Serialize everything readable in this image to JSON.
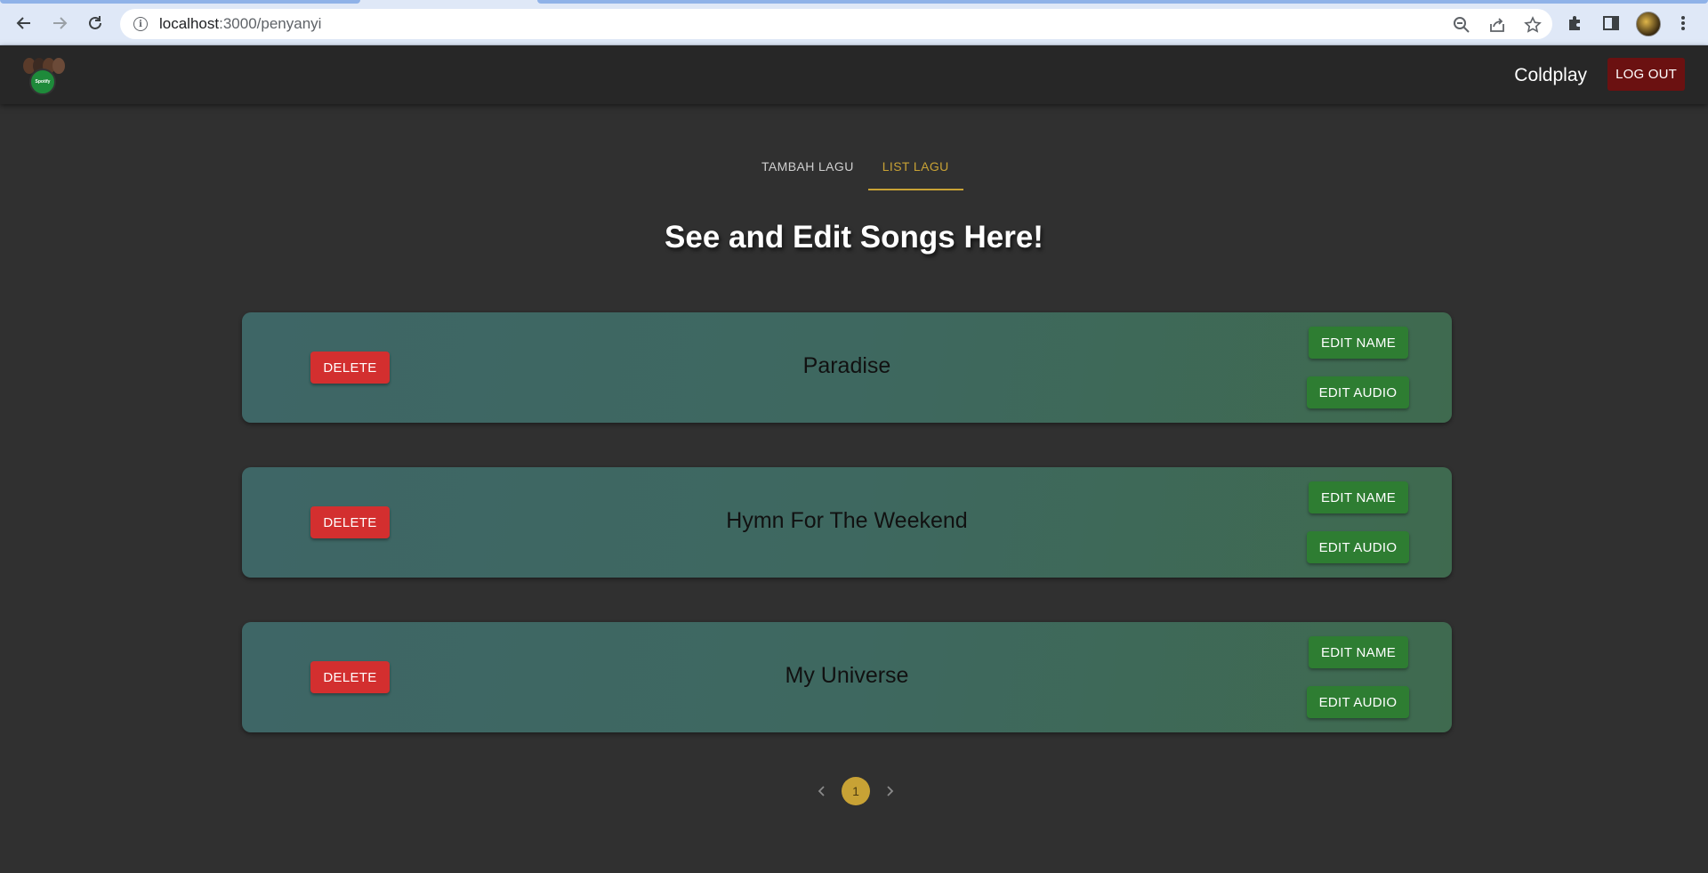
{
  "browser": {
    "url_host": "localhost",
    "url_path": ":3000/penyanyi",
    "icons": [
      "back-arrow-icon",
      "forward-arrow-icon",
      "reload-icon",
      "site-info-icon",
      "zoom-out-icon",
      "share-icon",
      "bookmark-star-icon",
      "extensions-puzzle-icon",
      "side-panel-icon",
      "profile-avatar",
      "more-vert-icon"
    ]
  },
  "header": {
    "logo_text": "Spotify",
    "artist_name": "Coldplay",
    "logout_label": "LOG OUT"
  },
  "tabs": [
    {
      "label": "TAMBAH LAGU",
      "active": false
    },
    {
      "label": "LIST LAGU",
      "active": true
    }
  ],
  "page_title": "See and Edit Songs Here!",
  "songs": [
    {
      "title": "Paradise",
      "delete_label": "DELETE",
      "edit_name_label": "EDIT NAME",
      "edit_audio_label": "EDIT AUDIO"
    },
    {
      "title": "Hymn For The Weekend",
      "delete_label": "DELETE",
      "edit_name_label": "EDIT NAME",
      "edit_audio_label": "EDIT AUDIO"
    },
    {
      "title": "My Universe",
      "delete_label": "DELETE",
      "edit_name_label": "EDIT NAME",
      "edit_audio_label": "EDIT AUDIO"
    }
  ],
  "pagination": {
    "current_page": "1",
    "prev_icon": "chevron-left-icon",
    "next_icon": "chevron-right-icon"
  },
  "colors": {
    "accent": "#c8a235",
    "delete": "#d32f2f",
    "edit": "#2e7d32",
    "logout": "#6b1111",
    "background": "#303030"
  }
}
